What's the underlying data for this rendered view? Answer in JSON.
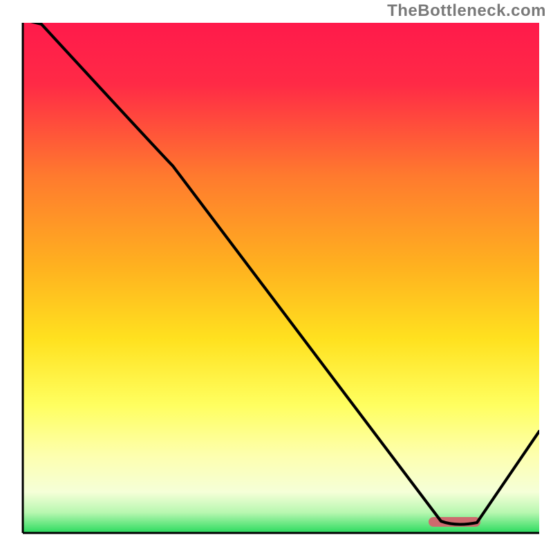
{
  "watermark_text": "TheBottleneck.com",
  "colors": {
    "grad_top": "#ff1a4b",
    "grad_mid1": "#ff7a2e",
    "grad_mid2": "#ffd21f",
    "grad_mid3": "#ffff60",
    "grad_mid4": "#fdffc7",
    "grad_bottom": "#2adb5e",
    "axis": "#000000",
    "curve": "#000000",
    "marker": "#cd6b6e"
  },
  "chart_data": {
    "type": "line",
    "title": "",
    "xlabel": "",
    "ylabel": "",
    "xlim": [
      0,
      100
    ],
    "ylim": [
      0,
      100
    ],
    "grid": false,
    "legend": false,
    "x": [
      0,
      3,
      28,
      81,
      86,
      100
    ],
    "values": [
      100,
      100,
      75,
      2,
      2,
      20
    ],
    "optimal_marker": {
      "x_start": 79,
      "x_end": 88,
      "y": 2
    },
    "annotations": []
  }
}
